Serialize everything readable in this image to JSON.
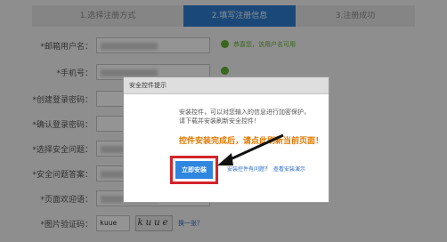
{
  "steps": [
    {
      "label": "1.选择注册方式"
    },
    {
      "label": "2.填写注册信息"
    },
    {
      "label": "3.注册成功"
    }
  ],
  "form": {
    "labels": [
      "*邮箱用户名：",
      "*手机号：",
      "*创建登录密码：",
      "*确认登录密码：",
      "*选择安全问题：",
      "*安全问题答案：",
      "*页面欢迎语：",
      "*图片验证码："
    ],
    "username_hint": "恭喜您，该用户名可用",
    "captcha_value": "kuue",
    "captcha_image_text": "kuue",
    "refresh_link": "换一张？"
  },
  "dialog": {
    "title": "安全控件提示",
    "description": "安装控件，可以对您输入的信息进行加密保护，请下载并安装刷新安全控件！",
    "warning": "控件安装完成后，请点此刷新当前页面！",
    "install_button": "立即安装",
    "help_link": "安装控件有问题？",
    "separator": "|",
    "demo_link": "查看安装演示"
  },
  "colors": {
    "accent": "#2e7fd1",
    "highlight_frame": "#d3242b",
    "warning_text": "#e07800",
    "success": "#5fb32f"
  }
}
